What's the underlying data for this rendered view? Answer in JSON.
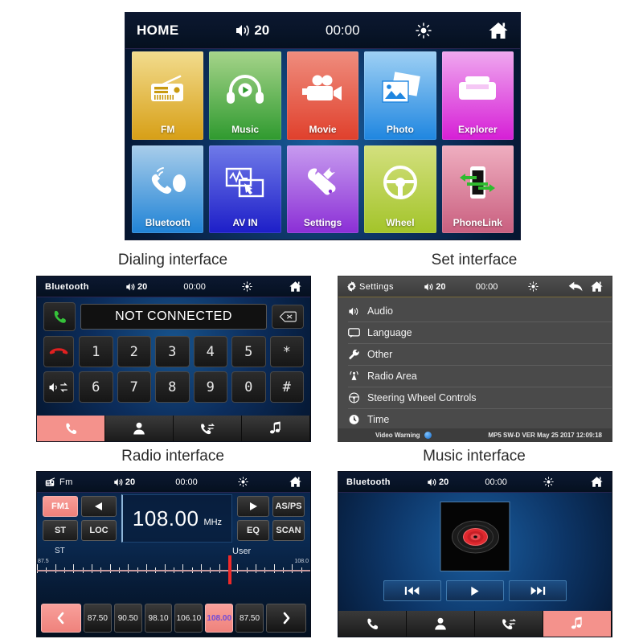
{
  "page": {
    "background": "#ffffff",
    "captions": [
      {
        "text": "Dialing interface"
      },
      {
        "text": "Set interface"
      },
      {
        "text": "Radio interface"
      },
      {
        "text": "Music interface"
      }
    ]
  },
  "home": {
    "statusbar": {
      "title": "HOME",
      "volume": "20",
      "clock": "00:00",
      "brightness_icon": "brightness-icon",
      "home_icon": "home-icon",
      "volume_icon": "volume-icon"
    },
    "tiles": [
      {
        "label": "FM",
        "icon": "radio-icon",
        "color_from": "#f2dc8e",
        "color_to": "#d79f16"
      },
      {
        "label": "Music",
        "icon": "headphones-icon",
        "color_from": "#a6d48a",
        "color_to": "#2f9a2f"
      },
      {
        "label": "Movie",
        "icon": "camcorder-icon",
        "color_from": "#ef8d7e",
        "color_to": "#e0402c"
      },
      {
        "label": "Photo",
        "icon": "photos-icon",
        "color_from": "#9ed0f4",
        "color_to": "#1f86e0"
      },
      {
        "label": "Explorer",
        "icon": "folder-icon",
        "color_from": "#efa8ef",
        "color_to": "#d61fd6"
      },
      {
        "label": "Bluetooth",
        "icon": "bluetooth-phone-icon",
        "color_from": "#a8cdea",
        "color_to": "#2083d6"
      },
      {
        "label": "AV IN",
        "icon": "av-in-icon",
        "color_from": "#6f7ae8",
        "color_to": "#1d1ec8"
      },
      {
        "label": "Settings",
        "icon": "tools-icon",
        "color_from": "#c79bef",
        "color_to": "#8b2fd6"
      },
      {
        "label": "Wheel",
        "icon": "steering-icon",
        "color_from": "#d3e07e",
        "color_to": "#a3c42a"
      },
      {
        "label": "PhoneLink",
        "icon": "phonelink-icon",
        "color_from": "#efaec0",
        "color_to": "#c95f7f"
      }
    ]
  },
  "dialing": {
    "statusbar": {
      "title": "Bluetooth",
      "volume": "20",
      "clock": "00:00"
    },
    "display_value": "NOT CONNECTED",
    "backspace_icon": "backspace-icon",
    "call_icon": "call-answer-icon",
    "hangup_icon": "call-end-icon",
    "audio_transfer_icon": "audio-transfer-icon",
    "keys": [
      "1",
      "2",
      "3",
      "4",
      "5",
      "*",
      "6",
      "7",
      "8",
      "9",
      "0",
      "#"
    ],
    "tabs": [
      {
        "icon": "phone-icon",
        "active": true
      },
      {
        "icon": "contacts-icon",
        "active": false
      },
      {
        "icon": "call-log-icon",
        "active": false
      },
      {
        "icon": "music-note-icon",
        "active": false
      }
    ]
  },
  "settings": {
    "statusbar": {
      "title": "Settings",
      "volume": "20",
      "clock": "00:00",
      "gear_icon": "gear-icon",
      "back_icon": "back-arrow-icon",
      "home_icon": "home-icon"
    },
    "items": [
      {
        "label": "Audio",
        "icon": "speaker-icon"
      },
      {
        "label": "Language",
        "icon": "speech-bubble-icon"
      },
      {
        "label": "Other",
        "icon": "wrench-icon"
      },
      {
        "label": "Radio Area",
        "icon": "antenna-icon"
      },
      {
        "label": "Steering Wheel Controls",
        "icon": "steering-wheel-icon"
      },
      {
        "label": "Time",
        "icon": "clock-icon"
      }
    ],
    "footer": {
      "left": "Video Warning",
      "indicator_icon": "blue-dot-indicator",
      "right": "MP5 SW-D VER May 25 2017 12:09:18"
    }
  },
  "radio": {
    "statusbar": {
      "title": "Fm",
      "volume": "20",
      "clock": "00:00",
      "band_icon": "radio-icon"
    },
    "band_button": "FM1",
    "prev_icon": "prev-arrow-icon",
    "next_icon": "next-arrow-icon",
    "buttons": {
      "st": "ST",
      "loc": "LOC",
      "asps": "AS/PS",
      "eq": "EQ",
      "scan": "SCAN"
    },
    "frequency": "108.00",
    "unit": "MHz",
    "scale": {
      "label_left": "ST",
      "label_right": "User",
      "min": "87.5",
      "max": "108.0",
      "cursor_pct": 70
    },
    "presets": [
      "87.50",
      "90.50",
      "98.10",
      "106.10",
      "108.00",
      "87.50"
    ],
    "selected_preset_index": 4,
    "nav_prev_icon": "chevron-left-icon",
    "nav_next_icon": "chevron-right-icon"
  },
  "music": {
    "statusbar": {
      "title": "Bluetooth",
      "volume": "20",
      "clock": "00:00"
    },
    "album_art_icon": "vinyl-record-icon",
    "transport": [
      {
        "icon": "previous-track-icon"
      },
      {
        "icon": "play-icon"
      },
      {
        "icon": "next-track-icon"
      }
    ],
    "tabs": [
      {
        "icon": "phone-icon",
        "active": false
      },
      {
        "icon": "contacts-icon",
        "active": false
      },
      {
        "icon": "call-log-icon",
        "active": false
      },
      {
        "icon": "music-note-icon",
        "active": true
      }
    ]
  }
}
